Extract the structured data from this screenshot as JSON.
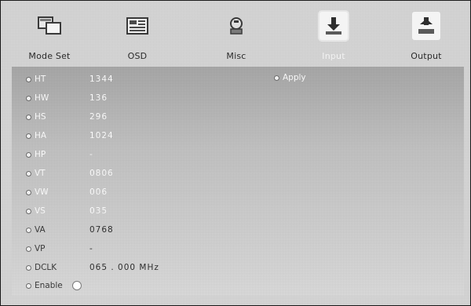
{
  "toolbar": {
    "items": [
      {
        "label": "Mode Set",
        "icon": "mode-set-icon",
        "selected": false
      },
      {
        "label": "OSD",
        "icon": "osd-icon",
        "selected": false
      },
      {
        "label": "Misc",
        "icon": "misc-icon",
        "selected": false
      },
      {
        "label": "Input",
        "icon": "input-icon",
        "selected": true
      },
      {
        "label": "Output",
        "icon": "output-icon",
        "selected": false
      }
    ]
  },
  "timing": {
    "rows": [
      {
        "key": "HT",
        "value": "1344"
      },
      {
        "key": "HW",
        "value": "136"
      },
      {
        "key": "HS",
        "value": "296"
      },
      {
        "key": "HA",
        "value": "1024"
      },
      {
        "key": "HP",
        "value": "-"
      },
      {
        "key": "VT",
        "value": "0806"
      },
      {
        "key": "VW",
        "value": "006"
      },
      {
        "key": "VS",
        "value": "035"
      },
      {
        "key": "VA",
        "value": "0768"
      },
      {
        "key": "VP",
        "value": "-"
      },
      {
        "key": "DCLK",
        "value": "065 . 000 MHz"
      }
    ],
    "apply_label": "Apply",
    "enable_label": "Enable"
  },
  "colors": {
    "panel_top": "#aeaeae",
    "panel_bottom": "#e2e2e2",
    "text_light": "#f7f7f7",
    "text_dark": "#2f2f2f"
  }
}
